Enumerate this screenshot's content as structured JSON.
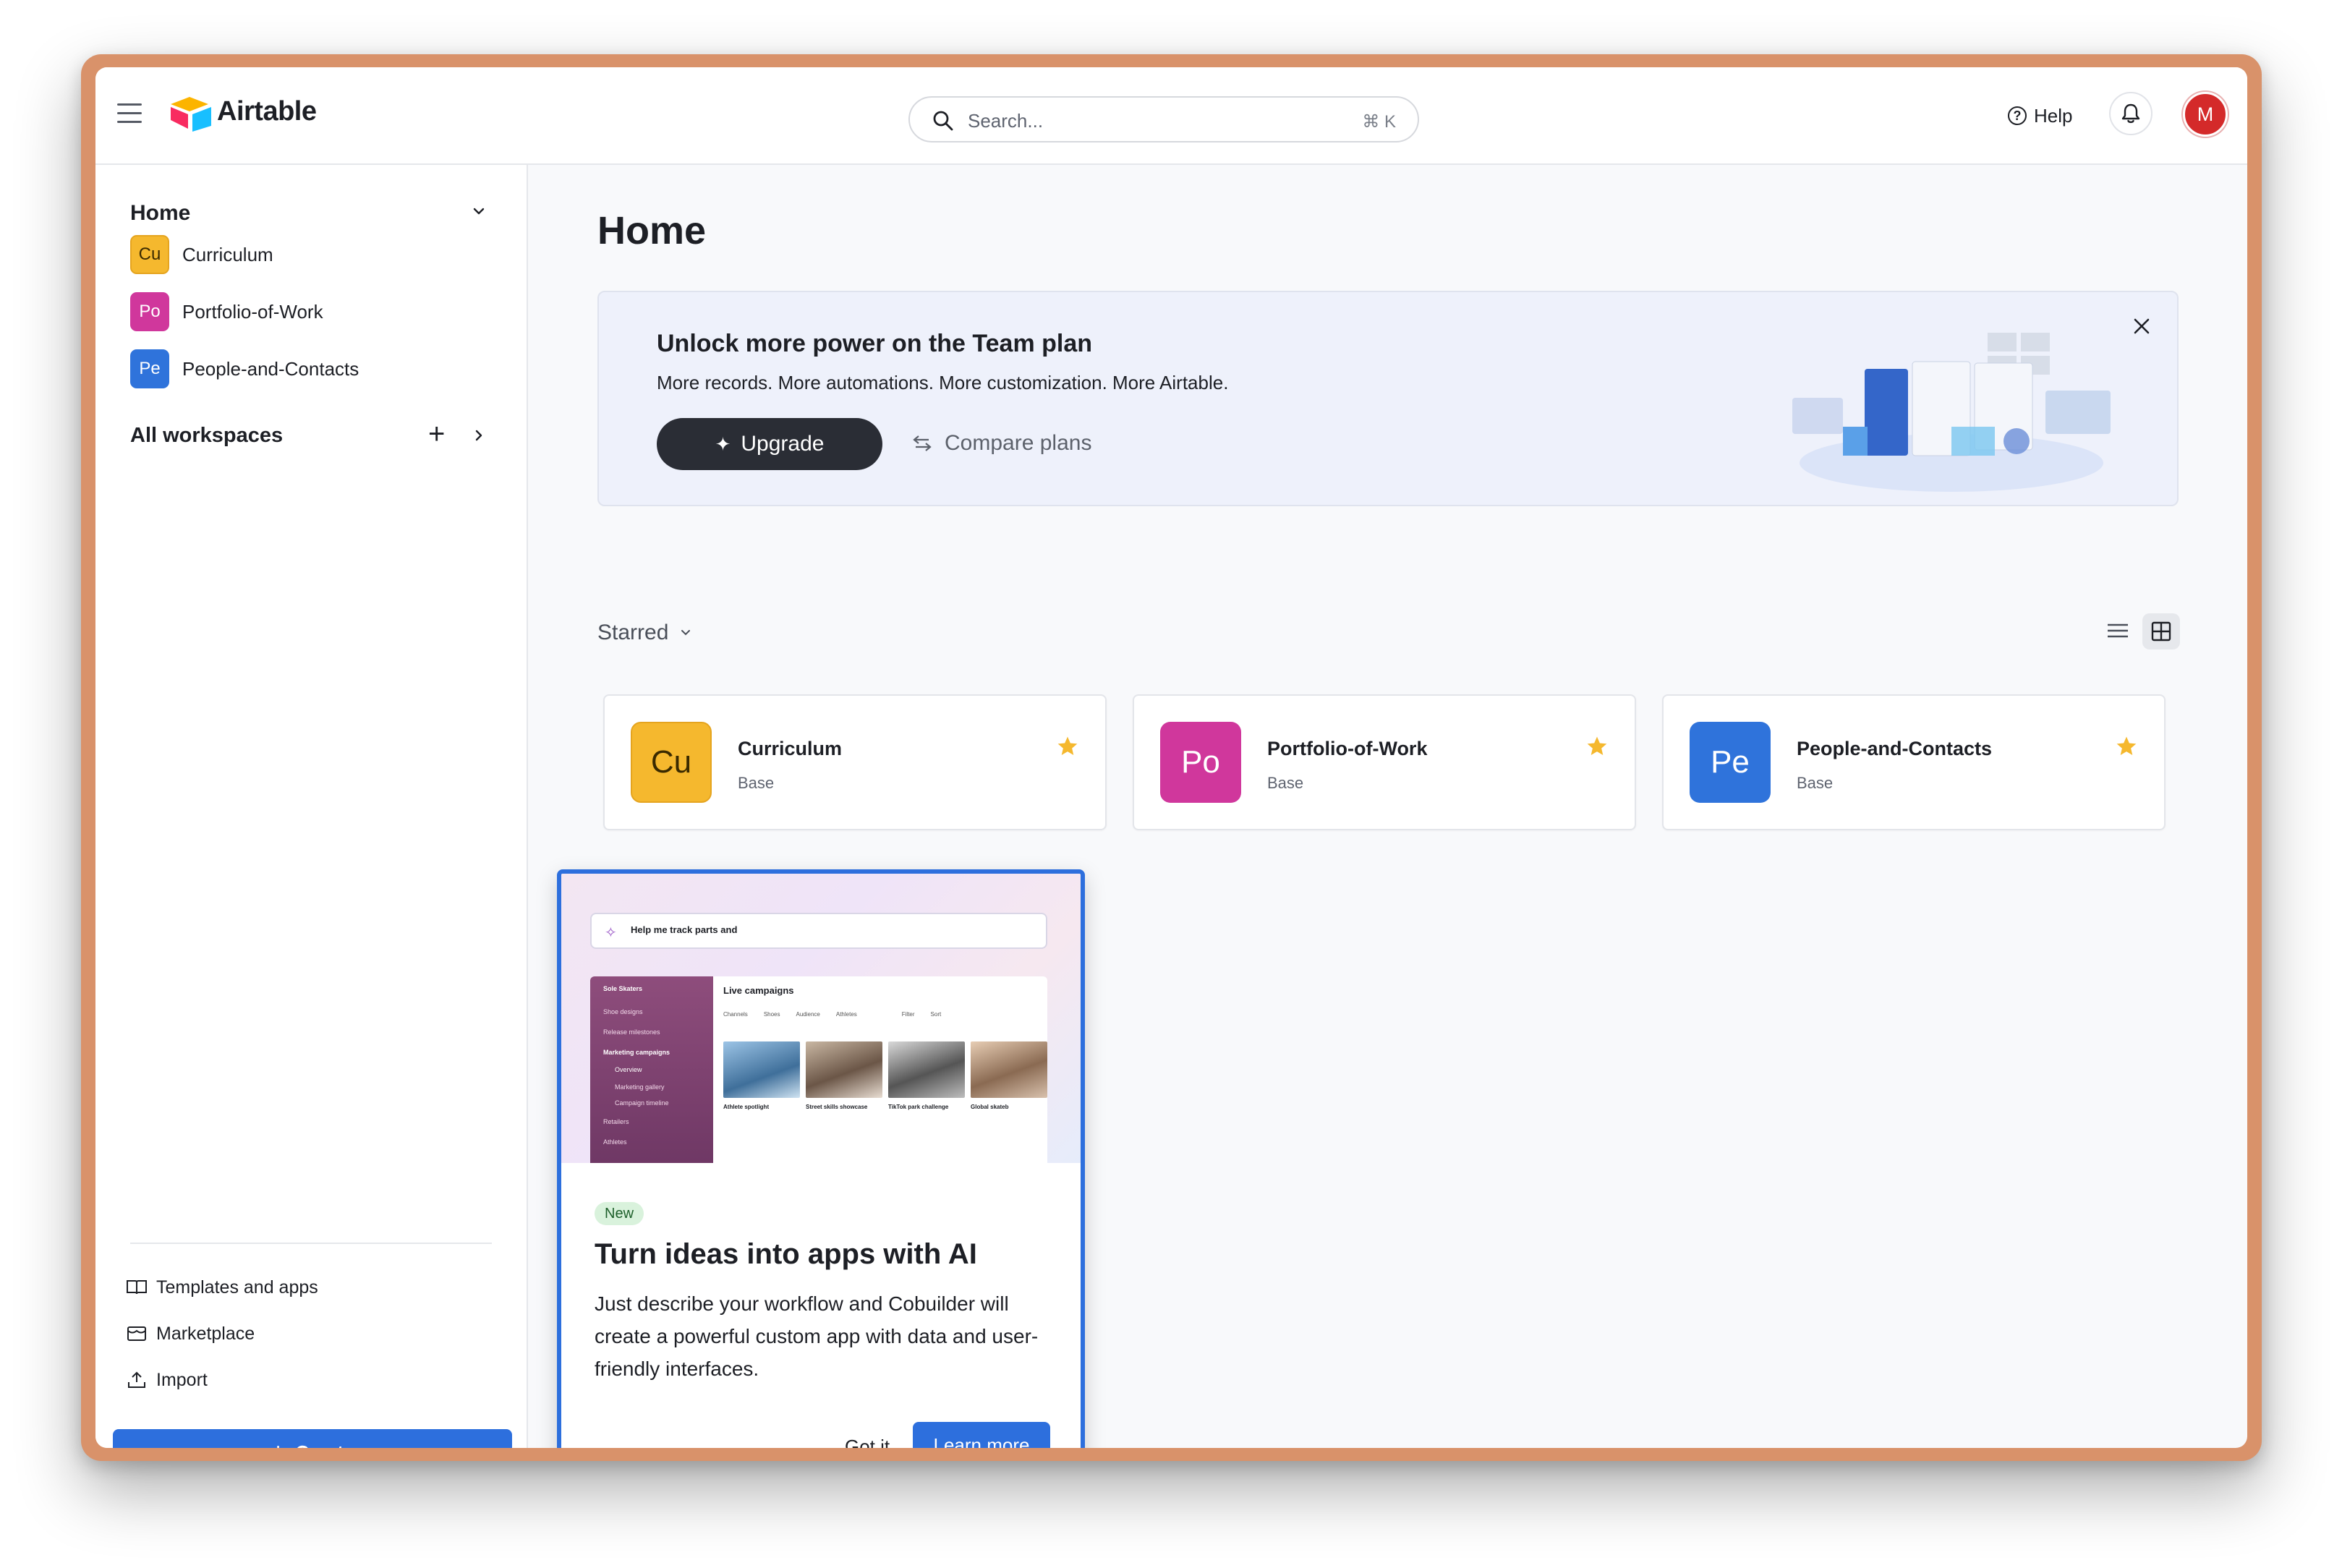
{
  "header": {
    "app_name": "Airtable",
    "search_placeholder": "Search...",
    "search_shortcut": "⌘ K",
    "help_label": "Help",
    "avatar_initial": "M"
  },
  "sidebar": {
    "home_label": "Home",
    "bases": [
      {
        "initials": "Cu",
        "name": "Curriculum"
      },
      {
        "initials": "Po",
        "name": "Portfolio-of-Work"
      },
      {
        "initials": "Pe",
        "name": "People-and-Contacts"
      }
    ],
    "all_workspaces_label": "All workspaces",
    "links": [
      {
        "label": "Templates and apps",
        "icon": "book-icon"
      },
      {
        "label": "Marketplace",
        "icon": "storefront-icon"
      },
      {
        "label": "Import",
        "icon": "upload-icon"
      }
    ],
    "create_label": "Create"
  },
  "main": {
    "title": "Home",
    "banner": {
      "title": "Unlock more power on the Team plan",
      "subtitle": "More records. More automations. More customization. More Airtable.",
      "upgrade_label": "Upgrade",
      "compare_label": "Compare plans"
    },
    "starred_label": "Starred",
    "cards": [
      {
        "initials": "Cu",
        "name": "Curriculum",
        "type": "Base"
      },
      {
        "initials": "Po",
        "name": "Portfolio-of-Work",
        "type": "Base"
      },
      {
        "initials": "Pe",
        "name": "People-and-Contacts",
        "type": "Base"
      }
    ]
  },
  "popover": {
    "prompt_text": "Help me track parts and",
    "mini_app": {
      "workspace": "Sole Skaters",
      "nav": [
        "Shoe designs",
        "Release milestones",
        "Marketing campaigns",
        "Overview",
        "Marketing gallery",
        "Campaign timeline",
        "Retailers",
        "Athletes"
      ],
      "view_title": "Live campaigns",
      "filters": [
        "Channels",
        "Shoes",
        "Audience",
        "Athletes",
        "Filter",
        "Sort"
      ],
      "records": [
        "Athlete spotlight",
        "Street skills showcase",
        "TikTok park challenge",
        "Global skateb"
      ]
    },
    "badge": "New",
    "title": "Turn ideas into apps with AI",
    "body": "Just describe your workflow and Cobuilder will create a powerful custom app with data and user-friendly interfaces.",
    "got_it_label": "Got it",
    "learn_more_label": "Learn more"
  },
  "colors": {
    "accent": "#2d6fdd",
    "badge_cu": "#f5b82e",
    "badge_po": "#d0379c",
    "badge_pe": "#2f73db",
    "star": "#f5b82e",
    "window_frame": "#d9926a"
  }
}
